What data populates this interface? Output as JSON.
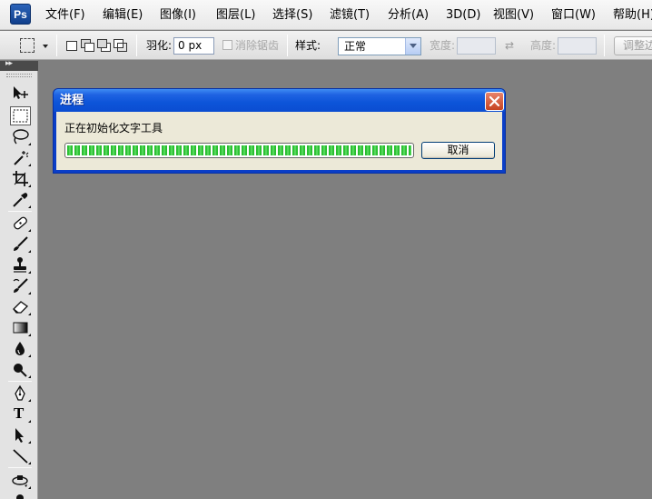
{
  "app": {
    "logo_text": "Ps"
  },
  "menu": {
    "items": [
      {
        "label": "文件(F)"
      },
      {
        "label": "编辑(E)"
      },
      {
        "label": "图像(I)"
      },
      {
        "label": "图层(L)"
      },
      {
        "label": "选择(S)"
      },
      {
        "label": "滤镜(T)"
      },
      {
        "label": "分析(A)"
      },
      {
        "label": "3D(D)"
      },
      {
        "label": "视图(V)"
      },
      {
        "label": "窗口(W)"
      },
      {
        "label": "帮助(H)"
      }
    ]
  },
  "options_bar": {
    "feather_label": "羽化:",
    "feather_value": "0 px",
    "antialias_label": "消除锯齿",
    "style_label": "样式:",
    "style_value": "正常",
    "width_label": "宽度:",
    "swap_symbol": "⇄",
    "height_label": "高度:",
    "refine_edge_label": "调整边缘..."
  },
  "toolbar": {
    "collapse_symbol": "▸▸",
    "tools": [
      {
        "name": "move-tool-icon",
        "active": false
      },
      {
        "name": "rectangular-marquee-tool-icon",
        "active": true
      },
      {
        "name": "lasso-tool-icon",
        "active": false
      },
      {
        "name": "magic-wand-tool-icon",
        "active": false
      },
      {
        "name": "crop-tool-icon",
        "active": false
      },
      {
        "name": "eyedropper-tool-icon",
        "active": false
      },
      {
        "name": "healing-brush-tool-icon",
        "active": false
      },
      {
        "name": "brush-tool-icon",
        "active": false
      },
      {
        "name": "clone-stamp-tool-icon",
        "active": false
      },
      {
        "name": "history-brush-tool-icon",
        "active": false
      },
      {
        "name": "eraser-tool-icon",
        "active": false
      },
      {
        "name": "gradient-tool-icon",
        "active": false
      },
      {
        "name": "blur-tool-icon",
        "active": false
      },
      {
        "name": "dodge-tool-icon",
        "active": false
      },
      {
        "name": "pen-tool-icon",
        "active": false
      },
      {
        "name": "type-tool-icon",
        "active": false
      },
      {
        "name": "path-selection-tool-icon",
        "active": false
      },
      {
        "name": "line-tool-icon",
        "active": false
      },
      {
        "name": "3d-rotate-tool-icon",
        "active": false
      }
    ],
    "type_glyph": "T"
  },
  "dialog": {
    "title": "进程",
    "message": "正在初始化文字工具",
    "progress_percent": 100,
    "cancel_label": "取消"
  }
}
